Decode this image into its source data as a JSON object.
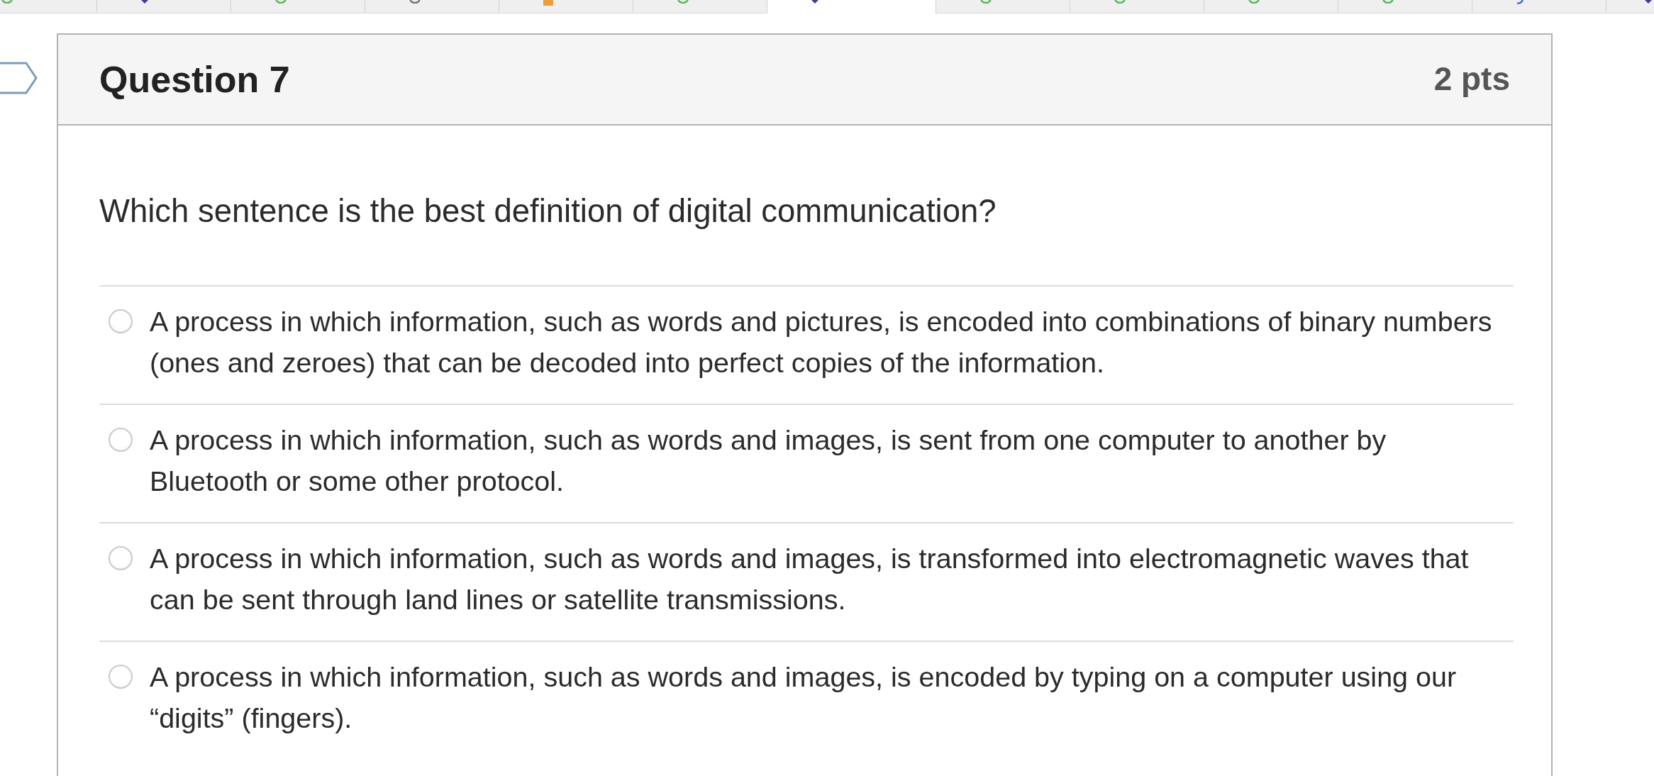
{
  "question_tabs": [
    {
      "selected": false,
      "marker": {
        "kind": "ring",
        "color": "#5cb85c"
      }
    },
    {
      "selected": false,
      "marker": {
        "kind": "pin",
        "color": "#4a3c96"
      }
    },
    {
      "selected": false,
      "marker": {
        "kind": "ring",
        "color": "#5cb85c"
      }
    },
    {
      "selected": false,
      "marker": {
        "kind": "ring",
        "color": "#777777"
      }
    },
    {
      "selected": false,
      "marker": {
        "kind": "square",
        "color": "#ef9a3f"
      }
    },
    {
      "selected": false,
      "marker": {
        "kind": "ring",
        "color": "#5cb85c"
      }
    },
    {
      "selected": true,
      "marker": {
        "kind": "pin",
        "color": "#4a3c96"
      }
    },
    {
      "selected": false,
      "marker": {
        "kind": "ring",
        "color": "#5cb85c"
      }
    },
    {
      "selected": false,
      "marker": {
        "kind": "ring",
        "color": "#5cb85c"
      }
    },
    {
      "selected": false,
      "marker": {
        "kind": "ring",
        "color": "#5cb85c"
      }
    },
    {
      "selected": false,
      "marker": {
        "kind": "ring",
        "color": "#5cb85c"
      }
    },
    {
      "selected": false,
      "marker": {
        "kind": "hook",
        "color": "#3b6fc6"
      }
    },
    {
      "selected": false,
      "marker": {
        "kind": "pin",
        "color": "#4a3c96"
      }
    }
  ],
  "flag": {
    "flagged": false
  },
  "question": {
    "title": "Question 7",
    "points": "2 pts",
    "prompt": "Which sentence is the best definition of digital communication?",
    "answers": [
      {
        "text": "A process in which information, such as words and pictures, is encoded into combinations of binary numbers (ones and zeroes) that can be decoded into perfect copies of the information.",
        "selected": false
      },
      {
        "text": "A process in which information, such as words and images, is sent from one computer to another by Bluetooth or some other protocol.",
        "selected": false
      },
      {
        "text": "A process in which information, such as words and images, is transformed into electromagnetic waves that can be sent through land lines or satellite transmissions.",
        "selected": false
      },
      {
        "text": "A process in which information, such as words and images, is encoded by typing on a computer using our “digits” (fingers).",
        "selected": false
      }
    ]
  }
}
